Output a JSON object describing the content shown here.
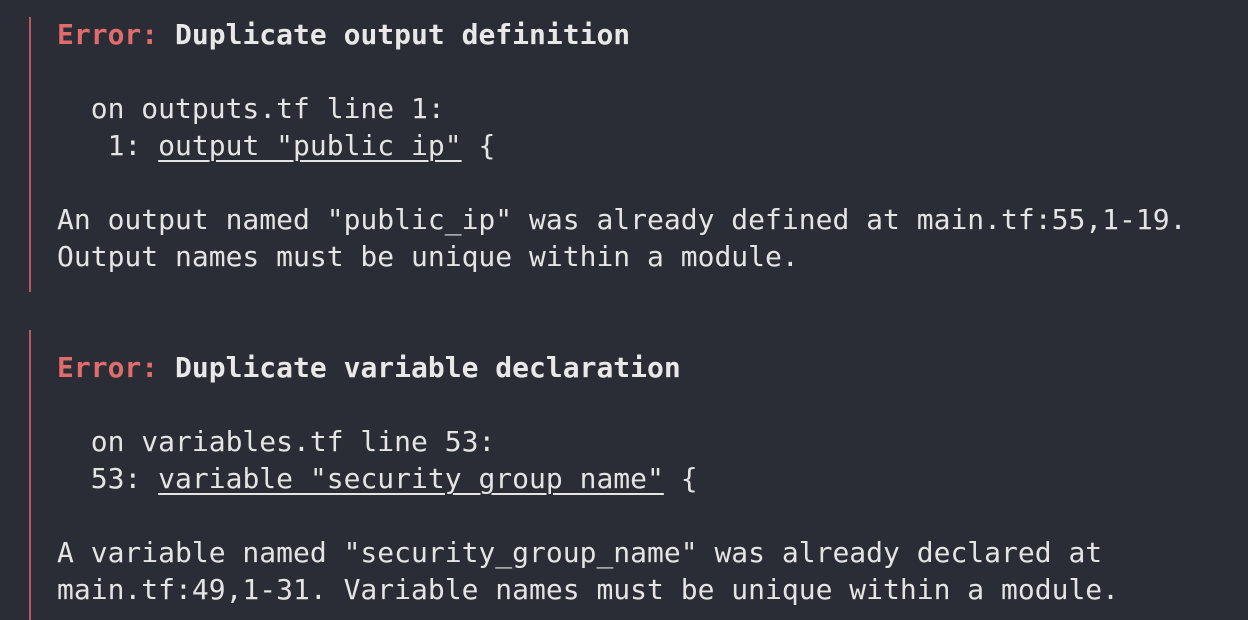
{
  "colors": {
    "background": "#2a2d35",
    "text": "#e4e4e4",
    "error_label": "#e06c6c",
    "border": "#b85a5a"
  },
  "errors": [
    {
      "label": "Error: ",
      "title": "Duplicate output definition",
      "location": "  on outputs.tf line 1:",
      "code_prefix": "   1: ",
      "code_underlined": "output \"public_ip\"",
      "code_suffix": " {",
      "message_lines": [
        "An output named \"public_ip\" was already defined at main.tf:55,1-19.",
        "Output names must be unique within a module."
      ]
    },
    {
      "label": "Error: ",
      "title": "Duplicate variable declaration",
      "location": "  on variables.tf line 53:",
      "code_prefix": "  53: ",
      "code_underlined": "variable \"security_group_name\"",
      "code_suffix": " {",
      "message_lines": [
        "A variable named \"security_group_name\" was already declared at",
        "main.tf:49,1-31. Variable names must be unique within a module."
      ]
    }
  ]
}
